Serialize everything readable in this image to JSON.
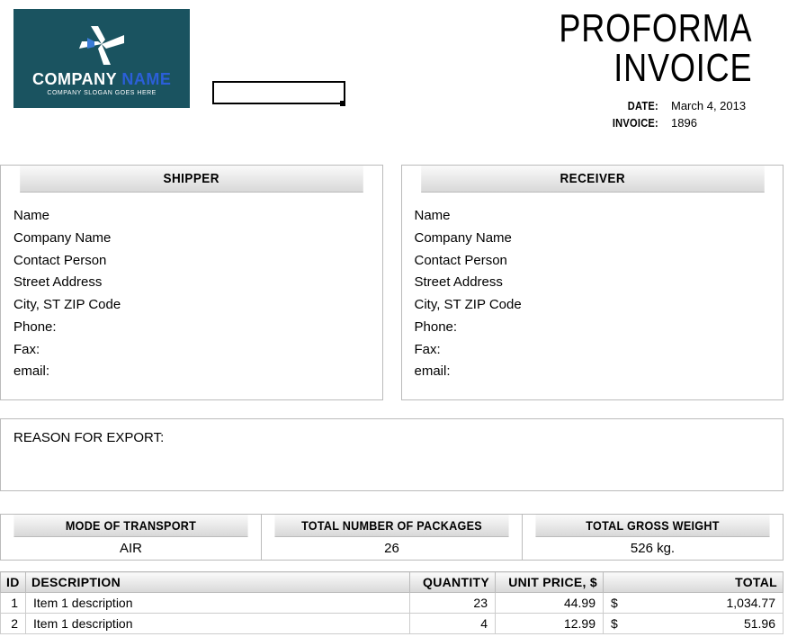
{
  "logo": {
    "company": "COMPANY",
    "name": "NAME",
    "slogan": "COMPANY SLOGAN GOES HERE"
  },
  "title": "PROFORMA INVOICE",
  "meta": {
    "date_label": "DATE:",
    "date": "March 4, 2013",
    "invoice_label": "INVOICE:",
    "invoice": "1896"
  },
  "shipper": {
    "heading": "SHIPPER",
    "name": "Name",
    "company": "Company Name",
    "contact": "Contact Person",
    "street": "Street Address",
    "city": "City, ST  ZIP Code",
    "phone": "Phone:",
    "fax": "Fax:",
    "email": "email:"
  },
  "receiver": {
    "heading": "RECEIVER",
    "name": "Name",
    "company": "Company Name",
    "contact": "Contact Person",
    "street": "Street Address",
    "city": "City, ST  ZIP Code",
    "phone": "Phone:",
    "fax": "Fax:",
    "email": "email:"
  },
  "reason_label": "REASON FOR EXPORT:",
  "summary": {
    "mode_label": "MODE OF TRANSPORT",
    "mode": "AIR",
    "packages_label": "TOTAL NUMBER OF PACKAGES",
    "packages": "26",
    "weight_label": "TOTAL GROSS WEIGHT",
    "weight": "526 kg."
  },
  "items_header": {
    "id": "ID",
    "desc": "DESCRIPTION",
    "qty": "QUANTITY",
    "unit": "UNIT PRICE, $",
    "total": "TOTAL"
  },
  "items": [
    {
      "id": "1",
      "desc": "Item 1 description",
      "qty": "23",
      "unit": "44.99",
      "currency": "$",
      "total": "1,034.77"
    },
    {
      "id": "2",
      "desc": "Item 1 description",
      "qty": "4",
      "unit": "12.99",
      "currency": "$",
      "total": "51.96"
    }
  ]
}
